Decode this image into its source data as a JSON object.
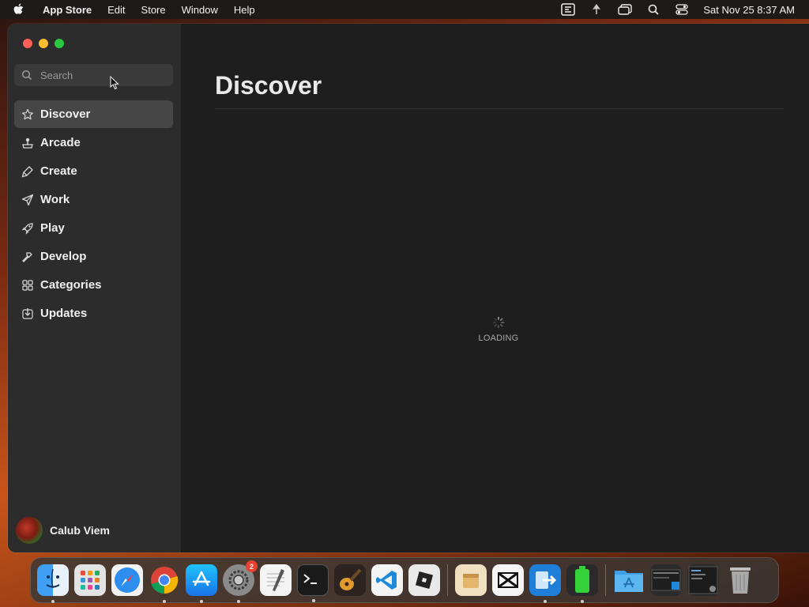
{
  "menubar": {
    "app_name": "App Store",
    "items": [
      "Edit",
      "Store",
      "Window",
      "Help"
    ],
    "clock": "Sat Nov 25  8:37 AM"
  },
  "sidebar": {
    "search_placeholder": "Search",
    "items": [
      {
        "label": "Discover",
        "icon": "star-icon",
        "active": true
      },
      {
        "label": "Arcade",
        "icon": "joystick-icon",
        "active": false
      },
      {
        "label": "Create",
        "icon": "brush-icon",
        "active": false
      },
      {
        "label": "Work",
        "icon": "paper-plane-icon",
        "active": false
      },
      {
        "label": "Play",
        "icon": "rocket-icon",
        "active": false
      },
      {
        "label": "Develop",
        "icon": "hammer-icon",
        "active": false
      },
      {
        "label": "Categories",
        "icon": "grid-icon",
        "active": false
      },
      {
        "label": "Updates",
        "icon": "download-icon",
        "active": false
      }
    ],
    "account_name": "Calub Viem"
  },
  "main": {
    "title": "Discover",
    "loading_text": "LOADING"
  },
  "dock": {
    "apps": [
      {
        "name": "finder",
        "running": true
      },
      {
        "name": "launchpad",
        "running": false
      },
      {
        "name": "safari",
        "running": false
      },
      {
        "name": "chrome",
        "running": true
      },
      {
        "name": "app-store",
        "running": true
      },
      {
        "name": "system-settings",
        "running": true,
        "badge": "2"
      },
      {
        "name": "textedit",
        "running": false
      },
      {
        "name": "terminal",
        "running": true
      },
      {
        "name": "garageband",
        "running": false
      },
      {
        "name": "vscode",
        "running": false
      },
      {
        "name": "roblox",
        "running": false
      },
      {
        "name": "archive-utility",
        "running": false
      },
      {
        "name": "capcut",
        "running": false
      },
      {
        "name": "migration-assistant",
        "running": true
      },
      {
        "name": "battery-app",
        "running": true
      },
      {
        "name": "applications-folder",
        "running": false
      },
      {
        "name": "recent-window-1",
        "running": false
      },
      {
        "name": "recent-window-2",
        "running": false
      },
      {
        "name": "trash",
        "running": false
      }
    ]
  },
  "colors": {
    "sidebar_bg": "#2c2c2c",
    "main_bg": "#1e1e1e",
    "active_item_bg": "#464646",
    "close": "#ff5f57",
    "minimize": "#febc2e",
    "zoom": "#28c840"
  }
}
